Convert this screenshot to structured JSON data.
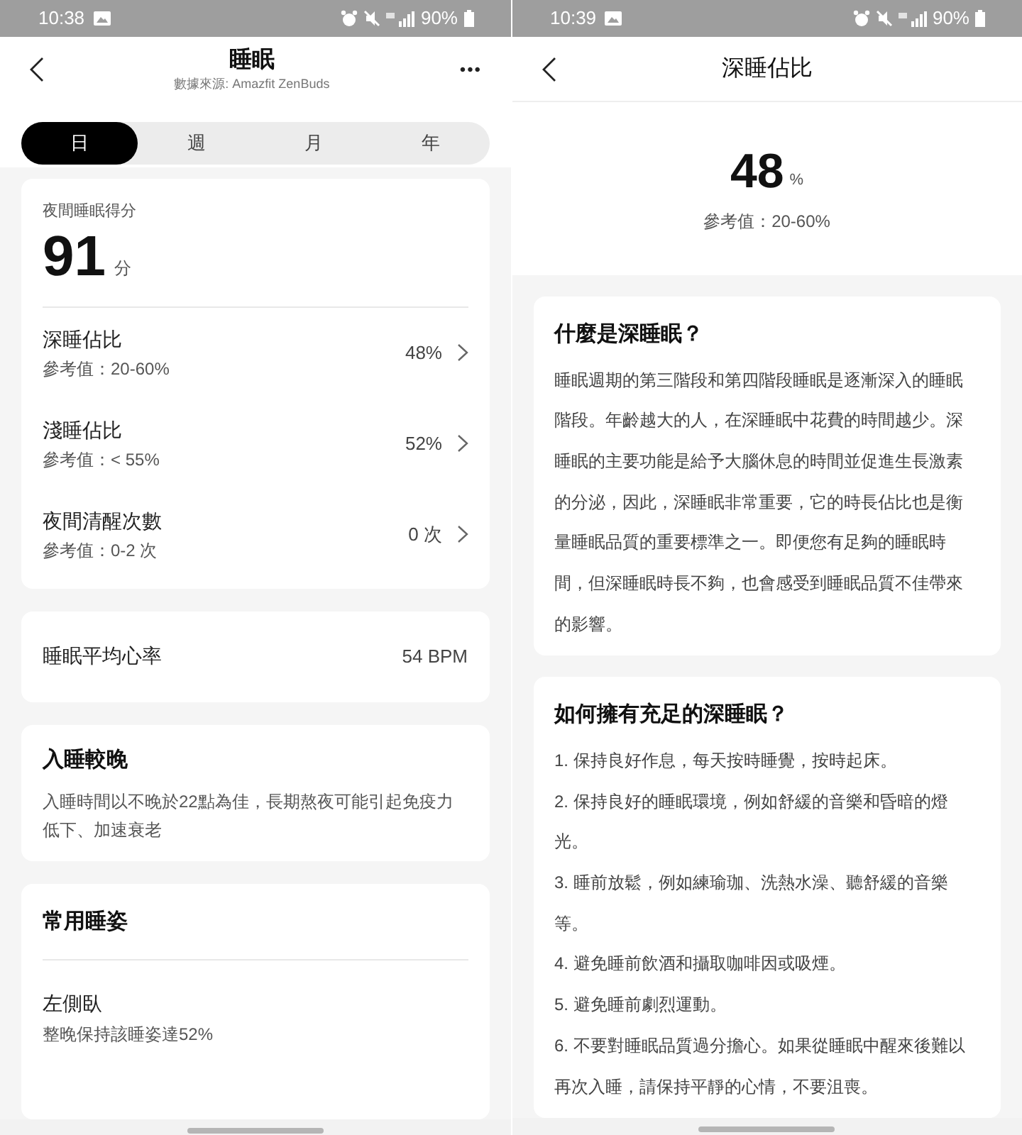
{
  "screens": [
    {
      "status_bar": {
        "time": "10:38",
        "battery": "90%"
      },
      "header": {
        "title": "睡眠",
        "subtitle": "數據來源: Amazfit ZenBuds",
        "more": "•••"
      },
      "tabs": [
        {
          "label": "日",
          "selected": true
        },
        {
          "label": "週",
          "selected": false
        },
        {
          "label": "月",
          "selected": false
        },
        {
          "label": "年",
          "selected": false
        }
      ],
      "score": {
        "label": "夜間睡眠得分",
        "value": "91",
        "unit": "分"
      },
      "metrics": [
        {
          "name": "深睡佔比",
          "reference": "參考值：20-60%",
          "value": "48%"
        },
        {
          "name": "淺睡佔比",
          "reference": "參考值：< 55%",
          "value": "52%"
        },
        {
          "name": "夜間清醒次數",
          "reference": "參考值：0-2 次",
          "value": "0 次"
        }
      ],
      "heart_rate": {
        "label": "睡眠平均心率",
        "value": "54 BPM"
      },
      "tip": {
        "title": "入睡較晚",
        "text": "入睡時間以不晚於22點為佳，長期熬夜可能引起免疫力低下、加速衰老"
      },
      "posture": {
        "title": "常用睡姿",
        "name": "左側臥",
        "detail": "整晚保持該睡姿達52%"
      }
    },
    {
      "status_bar": {
        "time": "10:39",
        "battery": "90%"
      },
      "header": {
        "title": "深睡佔比"
      },
      "summary": {
        "value": "48",
        "unit": "%",
        "reference": "參考值：20-60%"
      },
      "sections": [
        {
          "title": "什麼是深睡眠？",
          "paragraphs": [
            "睡眠週期的第三階段和第四階段睡眠是逐漸深入的睡眠階段。年齡越大的人，在深睡眠中花費的時間越少。深睡眠的主要功能是給予大腦休息的時間並促進生長激素的分泌，因此，深睡眠非常重要，它的時長佔比也是衡量睡眠品質的重要標準之一。即便您有足夠的睡眠時間，但深睡眠時長不夠，也會感受到睡眠品質不佳帶來的影響。"
          ]
        },
        {
          "title": "如何擁有充足的深睡眠？",
          "paragraphs": [
            "1. 保持良好作息，每天按時睡覺，按時起床。",
            "2. 保持良好的睡眠環境，例如舒緩的音樂和昏暗的燈光。",
            "3. 睡前放鬆，例如練瑜珈、洗熱水澡、聽舒緩的音樂等。",
            "4. 避免睡前飲酒和攝取咖啡因或吸煙。",
            "5. 避免睡前劇烈運動。",
            "6. 不要對睡眠品質過分擔心。如果從睡眠中醒來後難以再次入睡，請保持平靜的心情，不要沮喪。"
          ]
        }
      ]
    }
  ]
}
